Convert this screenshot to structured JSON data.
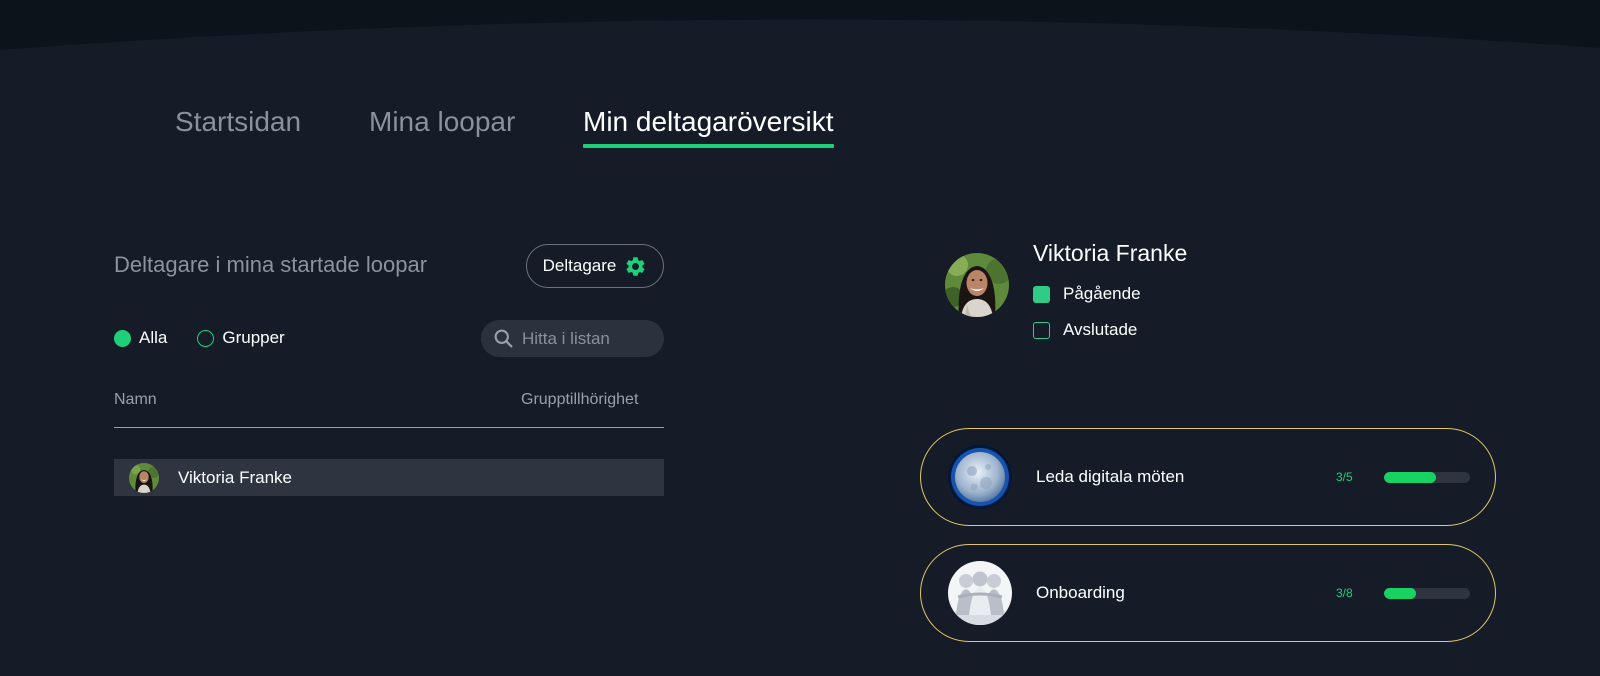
{
  "nav": {
    "tabs": [
      {
        "label": "Startsidan",
        "active": false
      },
      {
        "label": "Mina loopar",
        "active": false
      },
      {
        "label": "Min deltagaröversikt",
        "active": true
      }
    ]
  },
  "left": {
    "title": "Deltagare i mina startade loopar",
    "button_label": "Deltagare",
    "button_icon": "gear-icon",
    "filters": [
      {
        "label": "Alla",
        "selected": true
      },
      {
        "label": "Grupper",
        "selected": false
      }
    ],
    "search": {
      "placeholder": "Hitta i listan",
      "value": ""
    },
    "columns": [
      "Namn",
      "Grupptillhörighet"
    ],
    "rows": [
      {
        "name": "Viktoria Franke",
        "group": ""
      }
    ]
  },
  "right": {
    "person_name": "Viktoria Franke",
    "status_filters": [
      {
        "label": "Pågående",
        "checked": true
      },
      {
        "label": "Avslutade",
        "checked": false
      }
    ],
    "loops": [
      {
        "title": "Leda digitala möten",
        "count": "3/5",
        "progress": 0.6,
        "image": "moon-image"
      },
      {
        "title": "Onboarding",
        "count": "3/8",
        "progress": 0.375,
        "image": "group-figures-image"
      }
    ]
  },
  "colors": {
    "background": "#151c27",
    "accent": "#1fd07a",
    "card_border": "#e1c76a",
    "row_highlight": "#2e3541"
  }
}
